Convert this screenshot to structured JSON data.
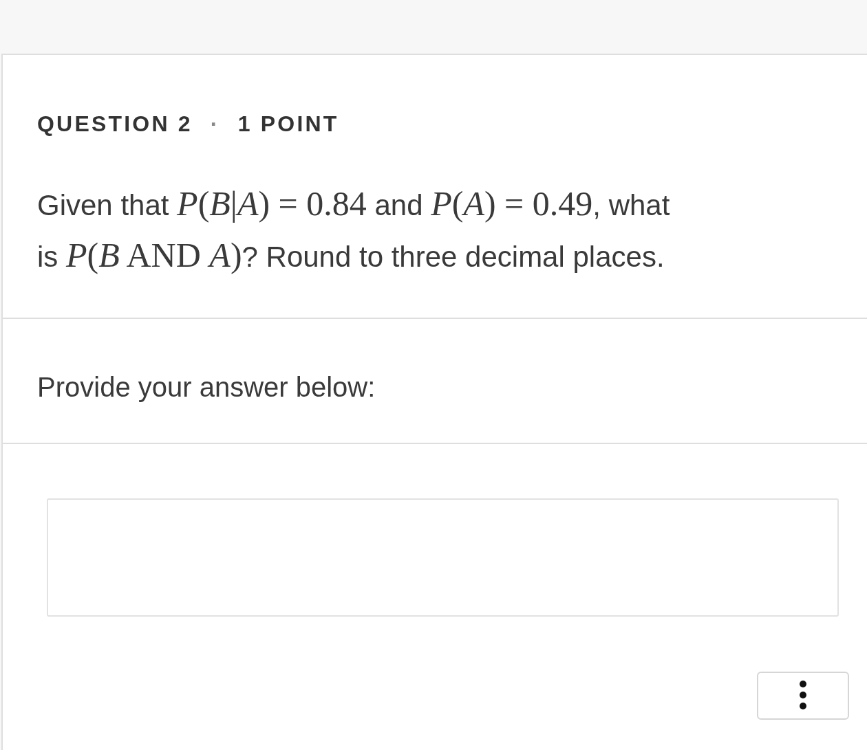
{
  "question": {
    "label": "QUESTION 2",
    "separator": "·",
    "points": "1 POINT",
    "prompt": [
      {
        "kind": "text",
        "text": "Given that "
      },
      {
        "kind": "math",
        "text": "*P*(*B*|*A*) = 0.84"
      },
      {
        "kind": "text",
        "text": " and "
      },
      {
        "kind": "math",
        "text": "*P*(*A*) = 0.49"
      },
      {
        "kind": "text",
        "text": ", what is "
      },
      {
        "kind": "math",
        "text": "*P*(*B* AND *A*)"
      },
      {
        "kind": "text",
        "text": "? Round to three decimal places."
      }
    ]
  },
  "answer": {
    "instruction": "Provide your answer below:"
  }
}
